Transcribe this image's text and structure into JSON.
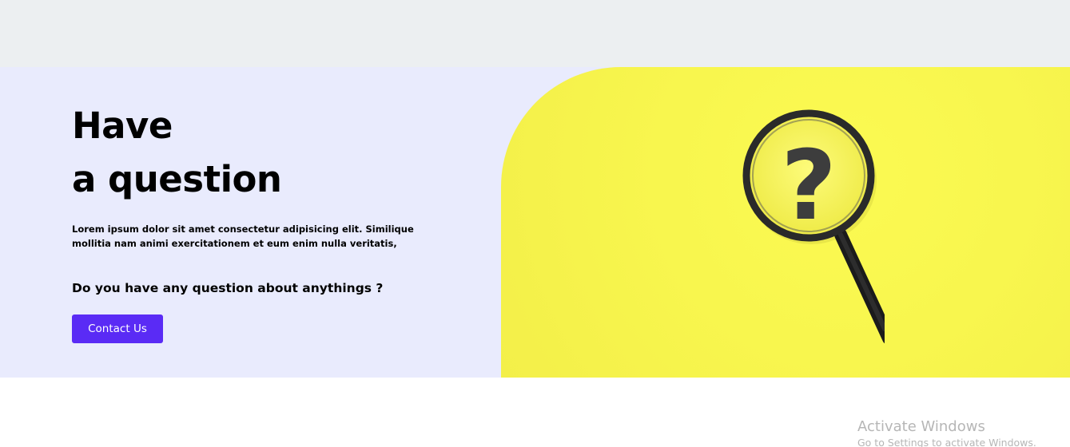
{
  "hero": {
    "title_line1": "Have",
    "title_line2": "a question",
    "description": "Lorem ipsum dolor sit amet consectetur adipisicing elit. Similique mollitia nam animi exercitationem et eum enim nulla veritatis,",
    "question": "Do you have any question about anythings ?",
    "button_label": "Contact Us",
    "image_icon": "magnifying-glass-question-mark-icon",
    "image_glyph": "?"
  },
  "watermark": {
    "title": "Activate Windows",
    "subtitle": "Go to Settings to activate Windows."
  },
  "colors": {
    "top_band": "#eceff1",
    "hero_background": "#e9ebfd",
    "image_panel": "#f8f64e",
    "button": "#5a2bf5",
    "button_text": "#ffffff",
    "text": "#000000",
    "watermark_text": "#b6b6b6"
  }
}
